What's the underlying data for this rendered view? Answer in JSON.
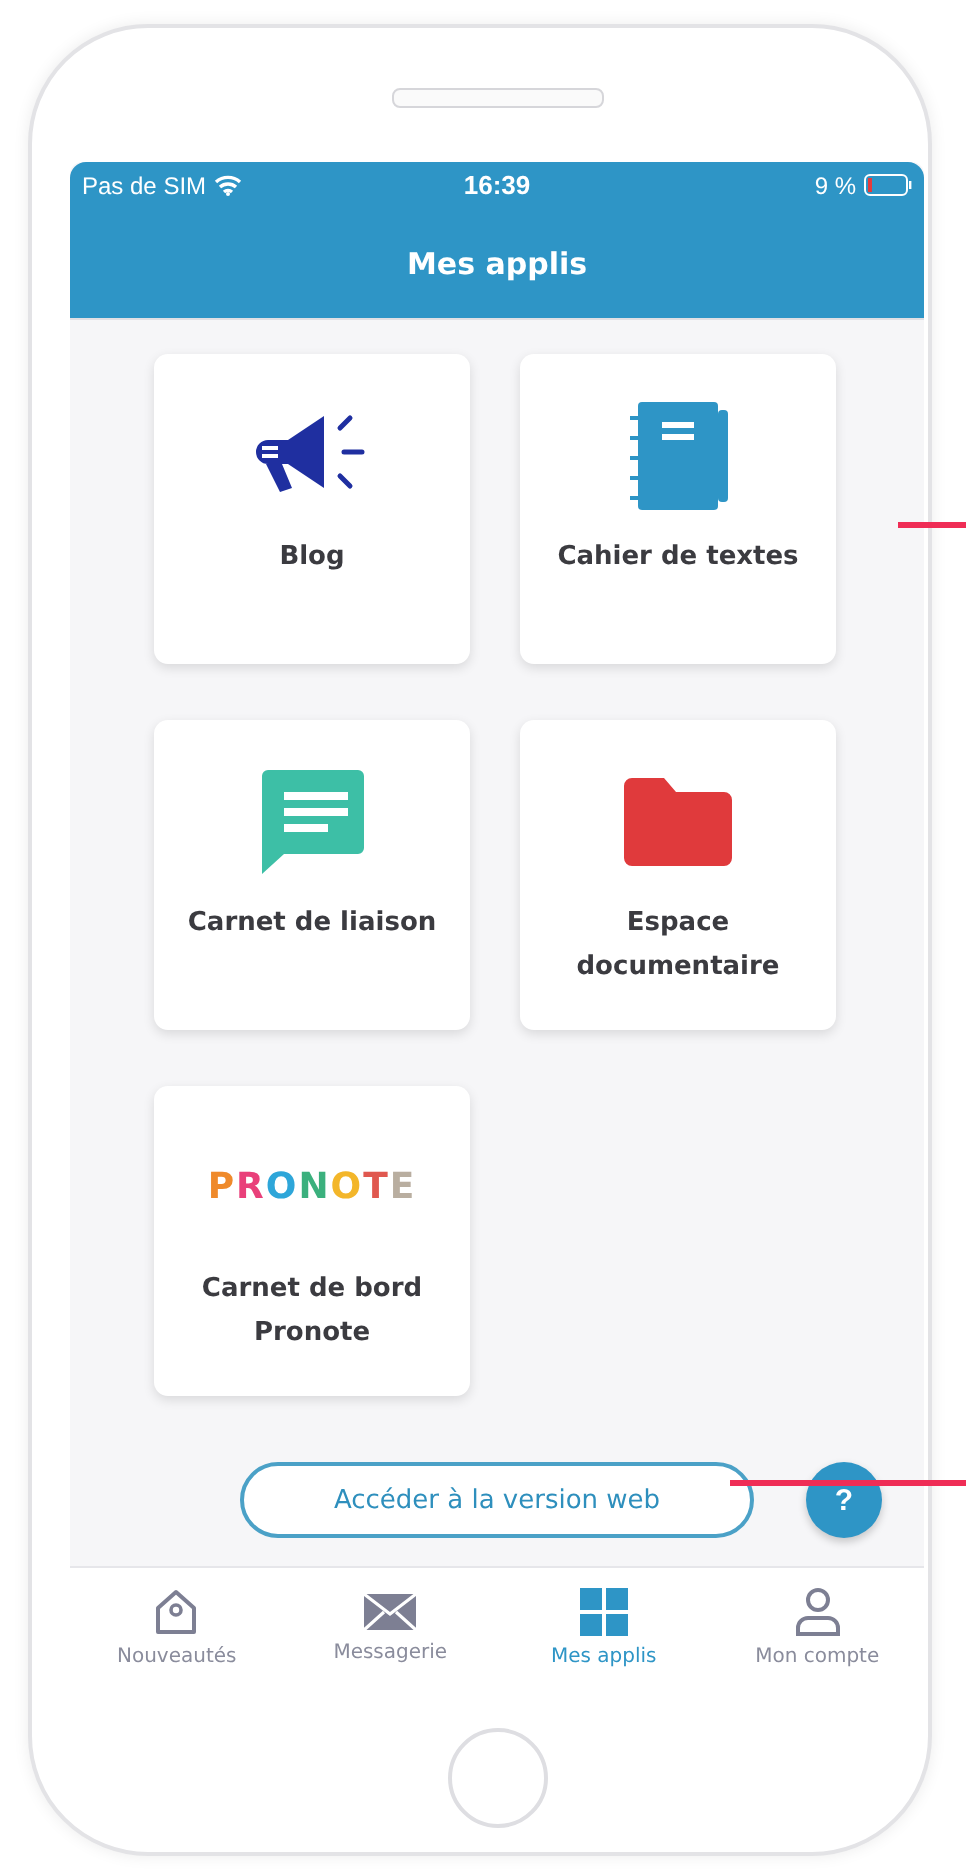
{
  "status_bar": {
    "carrier": "Pas de SIM",
    "time": "16:39",
    "battery": "9 %"
  },
  "header": {
    "title": "Mes applis"
  },
  "apps": [
    {
      "kind": "megaphone",
      "label": "Blog"
    },
    {
      "kind": "notebook",
      "label": "Cahier de textes"
    },
    {
      "kind": "speech",
      "label": "Carnet de liaison"
    },
    {
      "kind": "folder",
      "label": "Espace documentaire"
    },
    {
      "kind": "logo",
      "logo": "PRONOTE",
      "label": "Carnet de bord Pronote"
    }
  ],
  "web_button": {
    "label": "Accéder à la version web"
  },
  "help_button": {
    "label": "?"
  },
  "nav": [
    {
      "kind": "house",
      "label": "Nouveautés",
      "selected": false
    },
    {
      "kind": "envelope",
      "label": "Messagerie",
      "selected": false
    },
    {
      "kind": "grid",
      "label": "Mes applis",
      "selected": true
    },
    {
      "kind": "person",
      "label": "Mon compte",
      "selected": false
    }
  ]
}
